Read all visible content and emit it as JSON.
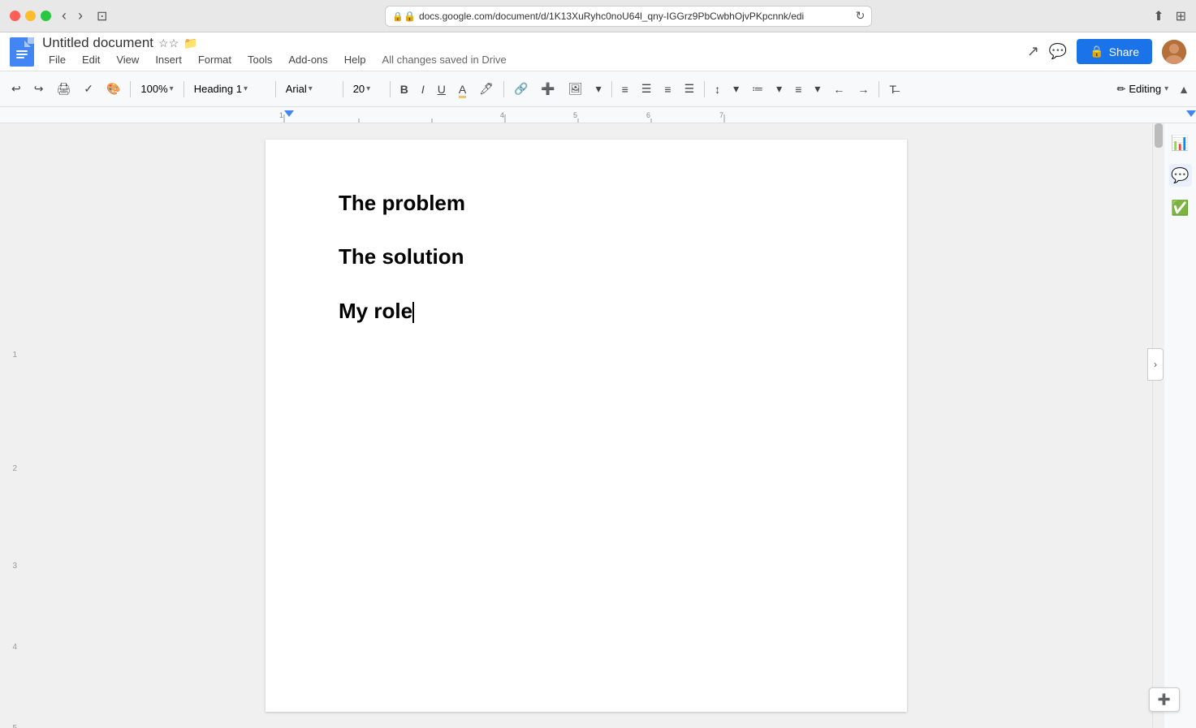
{
  "titlebar": {
    "url": "docs.google.com/document/d/1K13XuRyhc0noU64l_qny-IGGrz9PbCwbhOjvPKpcnnk/edi",
    "tabs": "····"
  },
  "app": {
    "doc_icon_alt": "Google Docs icon",
    "doc_title": "Untitled document",
    "save_status": "All changes saved in Drive",
    "menu_items": [
      "File",
      "Edit",
      "View",
      "Insert",
      "Format",
      "Tools",
      "Add-ons",
      "Help"
    ],
    "share_label": "Share"
  },
  "toolbar": {
    "zoom": "100%",
    "style": "Heading 1",
    "font": "Arial",
    "size": "20",
    "editing_mode": "Editing"
  },
  "document": {
    "lines": [
      {
        "text": "The problem",
        "type": "heading1"
      },
      {
        "text": "The solution",
        "type": "heading1"
      },
      {
        "text": "My role",
        "type": "heading1",
        "cursor": true
      }
    ]
  },
  "sidebar": {
    "icons": [
      "word-count",
      "comments",
      "tasks"
    ]
  },
  "bottom": {
    "add_label": "+"
  }
}
